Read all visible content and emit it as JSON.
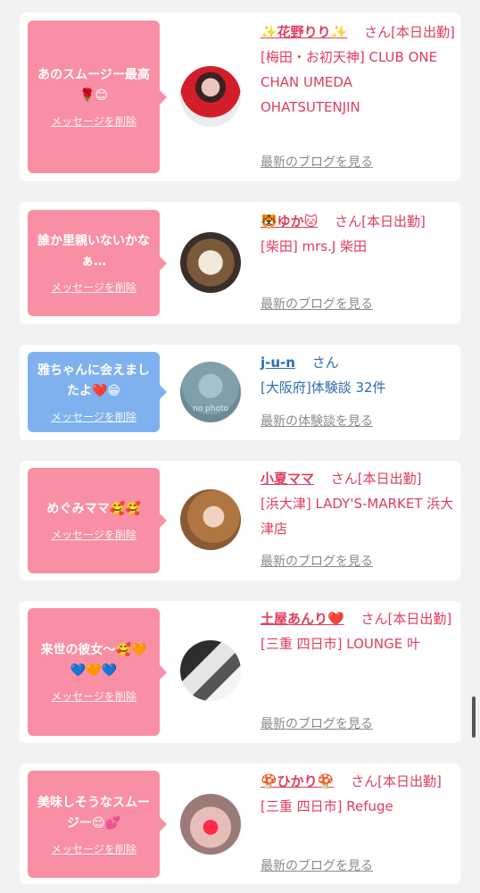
{
  "items": [
    {
      "message": "あのスムージー最高🌹😊",
      "delete_label": "メッセージを削除",
      "name": "✨花野りり✨",
      "honorific": "さん[本日出勤]",
      "detail": "[梅田・お初天神] CLUB ONE CHAN UMEDA OHATSUTENJIN",
      "link": "最新のブログを見る"
    },
    {
      "message": "誰か里親いないかなぁ…",
      "delete_label": "メッセージを削除",
      "name": "🐯ゆか🐱",
      "honorific": "さん[本日出勤]",
      "detail": "[柴田] mrs.J 柴田",
      "link": "最新のブログを見る"
    },
    {
      "message": "雅ちゃんに会えましたよ❤️😁",
      "delete_label": "メッセージを削除",
      "name": "j-u-n",
      "honorific": "さん",
      "detail": "[大阪府]体験談 32件",
      "link": "最新の体験談を見る"
    },
    {
      "message": "めぐみママ🥰🥰",
      "delete_label": "メッセージを削除",
      "name": "小夏ママ",
      "honorific": "さん[本日出勤]",
      "detail": "[浜大津] LADY'S-MARKET 浜大津店",
      "link": "最新のブログを見る"
    },
    {
      "message": "来世の彼女〜🥰🧡💙🧡💙",
      "delete_label": "メッセージを削除",
      "name": "土屋あんり❤️",
      "honorific": "さん[本日出勤]",
      "detail": "[三重 四日市] LOUNGE 叶",
      "link": "最新のブログを見る"
    },
    {
      "message": "美味しそうなスムージー😌💕",
      "delete_label": "メッセージを削除",
      "name": "🍄ひかり🍄",
      "honorific": "さん[本日出勤]",
      "detail": "[三重 四日市] Refuge",
      "link": "最新のブログを見る"
    }
  ],
  "colors": {
    "pink_bubble": "#f98fa4",
    "blue_bubble": "#7fb1ee",
    "pink_text": "#e03c5e",
    "blue_text": "#2b6cb0"
  },
  "avatar_placeholder": "no photo"
}
